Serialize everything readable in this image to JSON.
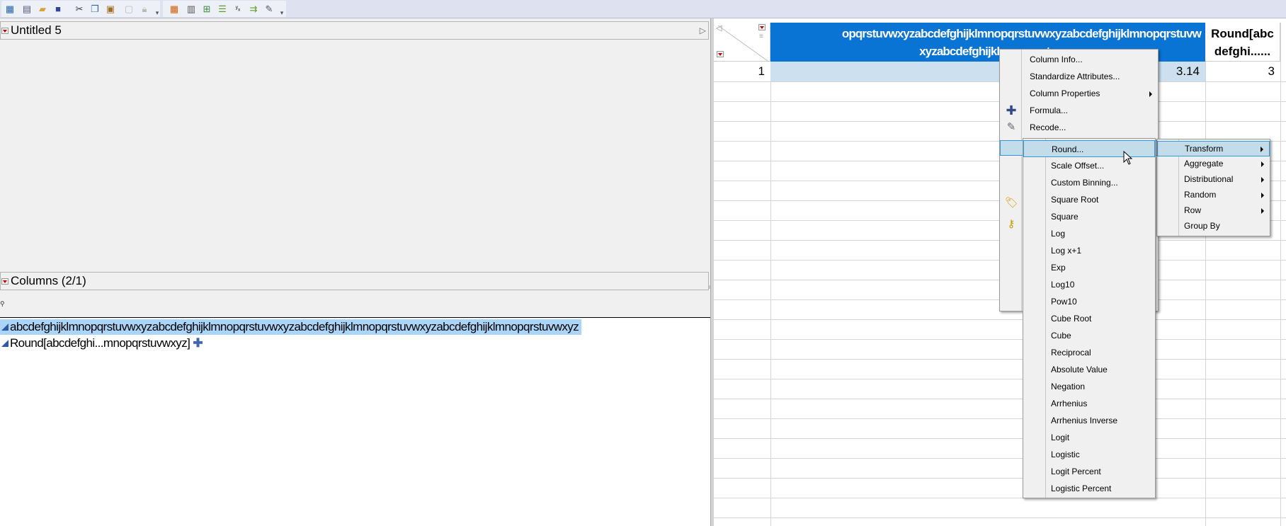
{
  "toolbar": {
    "icons": [
      "new-data-table-icon",
      "new-script-icon",
      "open-icon",
      "save-icon",
      "cut-icon",
      "copy-icon",
      "paste-icon",
      "properties-icon",
      "lock-icon",
      "overflow-icon",
      "data-grid-icon",
      "calculator-icon",
      "tabulate-icon",
      "bar-chart-icon",
      "fit-y-by-x-icon",
      "flow-icon",
      "edit-icon",
      "overflow-icon"
    ]
  },
  "table_panel": {
    "title": "Untitled 5"
  },
  "columns_panel": {
    "title": "Columns (2/1)",
    "search_icon": "search-icon",
    "items": [
      {
        "name": "abcdefghijklmnopqrstuvwxyzabcdefghijklmnopqrstuvwxyzabcdefghijklmnopqrstuvwxyzabcdefghijklmnopqrstuvwxyz",
        "selected": true
      },
      {
        "name": "Round[abcdefghi...mnopqrstuvwxyz]",
        "formula": true,
        "selected": false
      }
    ]
  },
  "grid": {
    "col1_header_line1": "opqrstuvwxyzabcdefghijklmnopqrstuvwxyzabcdefghijklmnopqrstuvw",
    "col1_header_line2": "xyzabcdefghijklmnopqrstu",
    "col2_header_line1": "Round[abc",
    "col2_header_line2": "defghi......",
    "rows": [
      {
        "num": "1",
        "col1": "3.14",
        "col2": "3"
      }
    ]
  },
  "context_menu": {
    "items": [
      {
        "label": "Column Info..."
      },
      {
        "label": "Standardize Attributes..."
      },
      {
        "label": "Column Properties",
        "submenu": true
      },
      {
        "label": "Formula...",
        "icon": "formula-plus-icon"
      },
      {
        "label": "Recode...",
        "icon": "recode-icon"
      }
    ]
  },
  "new_formula_submenu": {
    "items": [
      {
        "label": "Transform",
        "submenu": true
      },
      {
        "label": "Aggregate",
        "submenu": true
      },
      {
        "label": "Distributional",
        "submenu": true
      },
      {
        "label": "Random",
        "submenu": true
      },
      {
        "label": "Row",
        "submenu": true
      },
      {
        "label": "Group By"
      }
    ]
  },
  "transform_submenu": {
    "items": [
      "Round...",
      "Scale Offset...",
      "Custom Binning...",
      "Square Root",
      "Square",
      "Log",
      "Log x+1",
      "Exp",
      "Log10",
      "Pow10",
      "Cube Root",
      "Cube",
      "Reciprocal",
      "Absolute Value",
      "Negation",
      "Arrhenius",
      "Arrhenius Inverse",
      "Logit",
      "Logistic",
      "Logit Percent",
      "Logistic Percent"
    ],
    "highlighted": "Round..."
  },
  "colors": {
    "selected_header": "#0a74d4",
    "selected_cell": "#cce0f0",
    "menu_highlight": "#c3dcea"
  }
}
